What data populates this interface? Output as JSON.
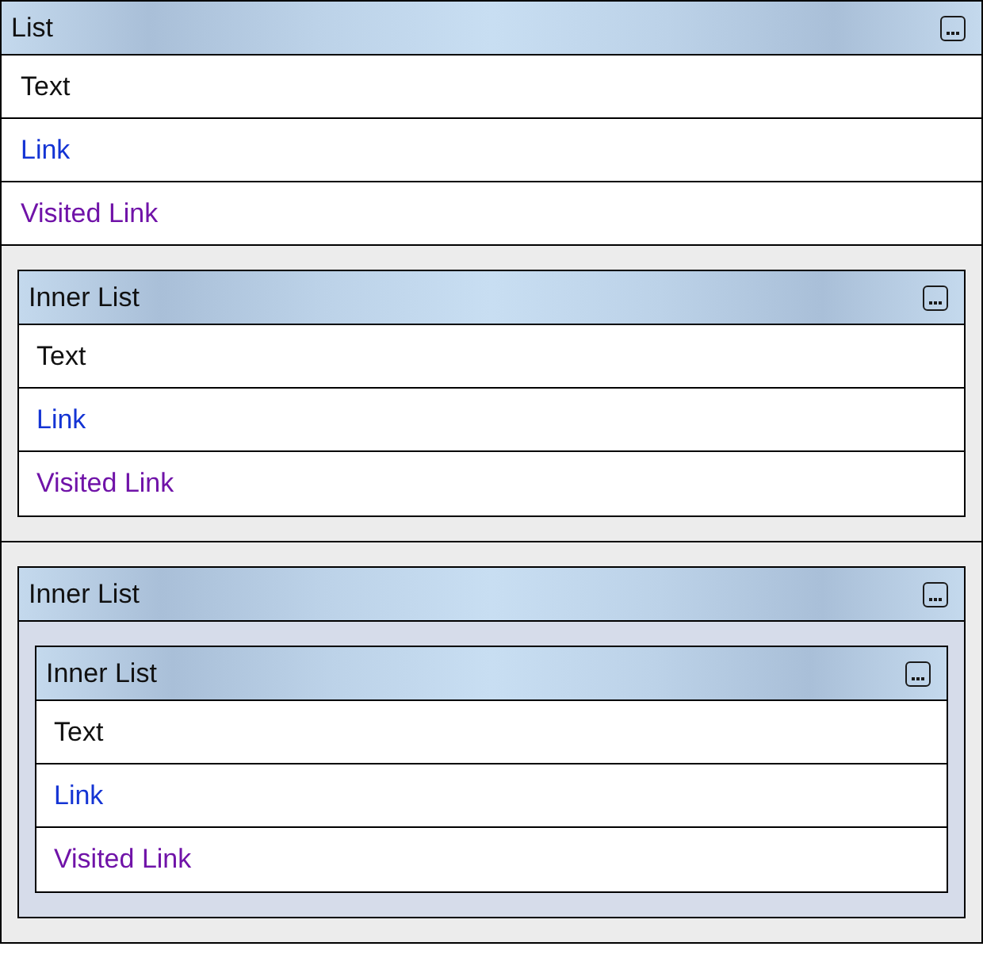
{
  "list": {
    "title": "List",
    "items": [
      {
        "kind": "text",
        "label": "Text"
      },
      {
        "kind": "link",
        "label": "Link",
        "visited": false
      },
      {
        "kind": "link",
        "label": "Visited Link",
        "visited": true
      },
      {
        "kind": "list",
        "title": "Inner List",
        "items": [
          {
            "kind": "text",
            "label": "Text"
          },
          {
            "kind": "link",
            "label": "Link",
            "visited": false
          },
          {
            "kind": "link",
            "label": "Visited Link",
            "visited": true
          }
        ]
      },
      {
        "kind": "list",
        "title": "Inner List",
        "items": [
          {
            "kind": "list",
            "title": "Inner List",
            "items": [
              {
                "kind": "text",
                "label": "Text"
              },
              {
                "kind": "link",
                "label": "Link",
                "visited": false
              },
              {
                "kind": "link",
                "label": "Visited Link",
                "visited": true
              }
            ]
          }
        ]
      }
    ]
  }
}
